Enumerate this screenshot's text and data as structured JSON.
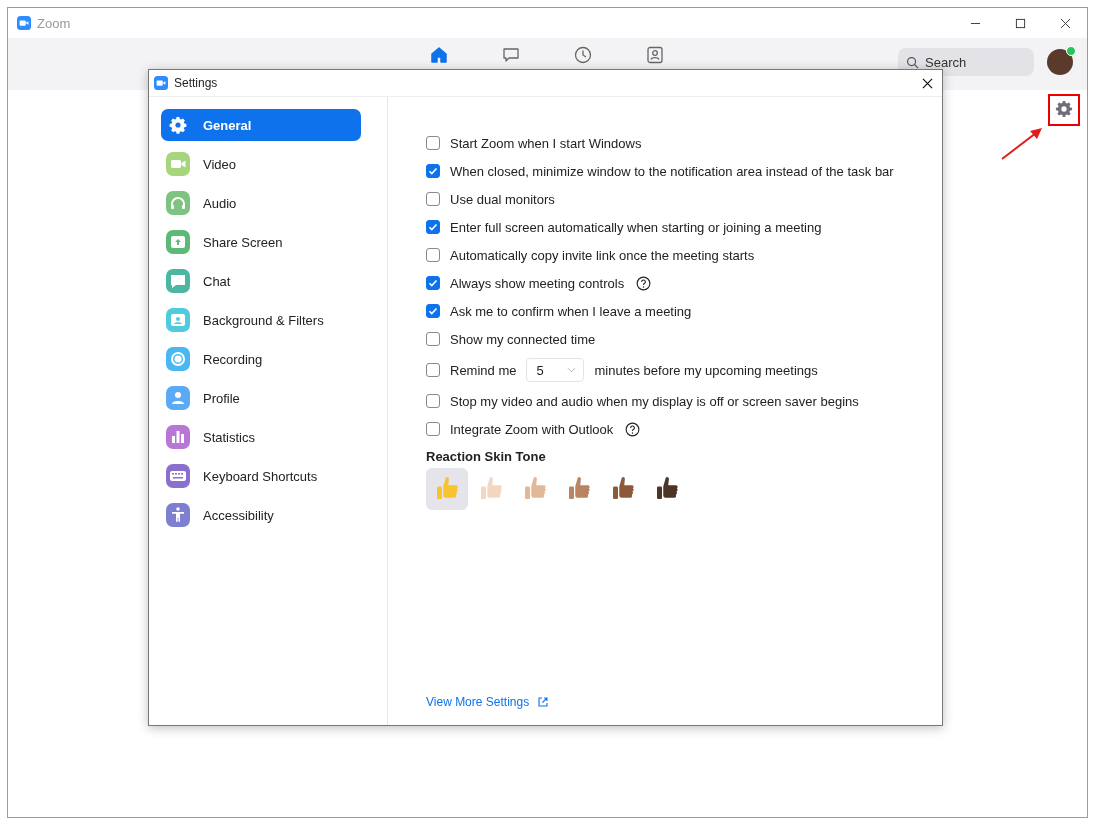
{
  "window": {
    "title": "Zoom"
  },
  "nav_tabs": [
    {
      "kind": "home",
      "selected": true
    },
    {
      "kind": "chat",
      "selected": false
    },
    {
      "kind": "clock",
      "selected": false
    },
    {
      "kind": "contacts",
      "selected": false
    }
  ],
  "search": {
    "placeholder": "Search"
  },
  "settings": {
    "title": "Settings",
    "sidebar": {
      "items": [
        {
          "label": "General",
          "kind": "gear",
          "color": "#0e72ed",
          "selected": true
        },
        {
          "label": "Video",
          "kind": "video",
          "color": "#a6d57d",
          "selected": false
        },
        {
          "label": "Audio",
          "kind": "audio",
          "color": "#7cc47f",
          "selected": false
        },
        {
          "label": "Share Screen",
          "kind": "share",
          "color": "#5cb978",
          "selected": false
        },
        {
          "label": "Chat",
          "kind": "chat",
          "color": "#4db6a3",
          "selected": false
        },
        {
          "label": "Background & Filters",
          "kind": "background",
          "color": "#4fcbde",
          "selected": false
        },
        {
          "label": "Recording",
          "kind": "recording",
          "color": "#4ab8f0",
          "selected": false
        },
        {
          "label": "Profile",
          "kind": "profile",
          "color": "#5aaaf5",
          "selected": false
        },
        {
          "label": "Statistics",
          "kind": "statistics",
          "color": "#b877d6",
          "selected": false
        },
        {
          "label": "Keyboard Shortcuts",
          "kind": "keyboard",
          "color": "#8a6fcf",
          "selected": false
        },
        {
          "label": "Accessibility",
          "kind": "accessibility",
          "color": "#7d7fd1",
          "selected": false
        }
      ]
    },
    "options": [
      {
        "kind": "checkbox",
        "label": "Start Zoom when I start Windows",
        "checked": false
      },
      {
        "kind": "checkbox",
        "label": "When closed, minimize window to the notification area instead of the task bar",
        "checked": true
      },
      {
        "kind": "checkbox",
        "label": "Use dual monitors",
        "checked": false
      },
      {
        "kind": "checkbox",
        "label": "Enter full screen automatically when starting or joining a meeting",
        "checked": true
      },
      {
        "kind": "checkbox",
        "label": "Automatically copy invite link once the meeting starts",
        "checked": false
      },
      {
        "kind": "checkbox_help",
        "label": "Always show meeting controls",
        "checked": true
      },
      {
        "kind": "checkbox",
        "label": "Ask me to confirm when I leave a meeting",
        "checked": true
      },
      {
        "kind": "checkbox",
        "label": "Show my connected time",
        "checked": false
      },
      {
        "kind": "remind",
        "label": "Remind me",
        "value": "5",
        "suffix": "minutes before my upcoming meetings",
        "checked": false
      },
      {
        "kind": "checkbox",
        "label": "Stop my video and audio when my display is off or screen saver begins",
        "checked": false
      },
      {
        "kind": "checkbox_help",
        "label": "Integrate Zoom with Outlook",
        "checked": false
      }
    ],
    "skin_tone": {
      "title": "Reaction Skin Tone",
      "tones": [
        {
          "color": "#f7c42f",
          "selected": true
        },
        {
          "color": "#f3d6c0",
          "selected": false
        },
        {
          "color": "#e3b898",
          "selected": false
        },
        {
          "color": "#b88462",
          "selected": false
        },
        {
          "color": "#8c5a3a",
          "selected": false
        },
        {
          "color": "#4e3424",
          "selected": false
        }
      ]
    },
    "more_link": "View More Settings"
  }
}
